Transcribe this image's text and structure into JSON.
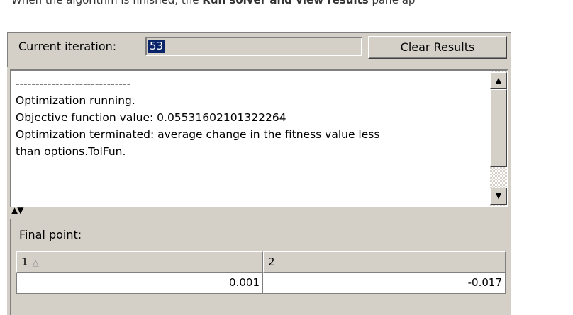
{
  "doc_text": {
    "prefix": "When the algorithm is finished, the ",
    "bold": "Run solver and view results",
    "suffix": " pane ap"
  },
  "iteration": {
    "label": "Current iteration:",
    "value": "53"
  },
  "clear_button": {
    "mnemonic": "C",
    "rest": "lear Results"
  },
  "log": {
    "lines": "-----------------------------\nOptimization running.\nObjective function value: 0.05531602101322264\nOptimization terminated: average change in the fitness value less\nthan options.TolFun."
  },
  "final_point": {
    "label": "Final point:",
    "columns": [
      "1",
      "2"
    ],
    "values": [
      "0.001",
      "-0.017"
    ]
  },
  "icons": {
    "sort": "sort-ascending-icon",
    "scroll_up": "scroll-up-icon",
    "scroll_down": "scroll-down-icon",
    "splitter": "splitter-arrows-icon"
  },
  "colors": {
    "panel_bg": "#d4d0c8",
    "selection_bg": "#0a246a"
  }
}
